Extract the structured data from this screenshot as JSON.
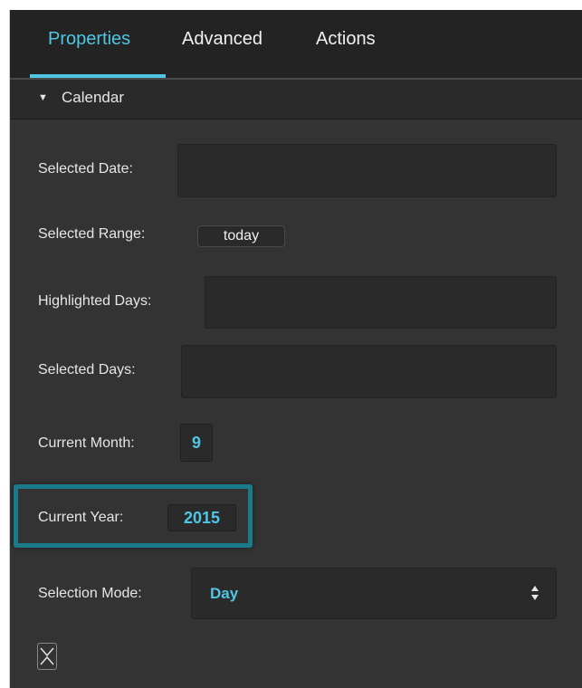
{
  "tabs": [
    {
      "label": "Properties",
      "active": true
    },
    {
      "label": "Advanced",
      "active": false
    },
    {
      "label": "Actions",
      "active": false
    }
  ],
  "section": {
    "title": "Calendar",
    "expanded": true
  },
  "fields": {
    "selected_date": {
      "label": "Selected Date:",
      "value": ""
    },
    "selected_range": {
      "label": "Selected Range:",
      "value": "today"
    },
    "highlighted_days": {
      "label": "Highlighted Days:",
      "value": ""
    },
    "selected_days": {
      "label": "Selected Days:",
      "value": ""
    },
    "current_month": {
      "label": "Current Month:",
      "value": "9"
    },
    "current_year": {
      "label": "Current Year:",
      "value": "2015"
    },
    "selection_mode": {
      "label": "Selection Mode:",
      "value": "Day"
    }
  },
  "colors": {
    "accent": "#4fc6e4",
    "panel_bg": "#333333",
    "tabbar_bg": "#232323",
    "highlight_border": "#1a7a8a"
  },
  "icons": {
    "section_toggle": "triangle-down-icon",
    "select_arrows": "up-down-arrows-icon",
    "collapse": "collapse-icon"
  }
}
